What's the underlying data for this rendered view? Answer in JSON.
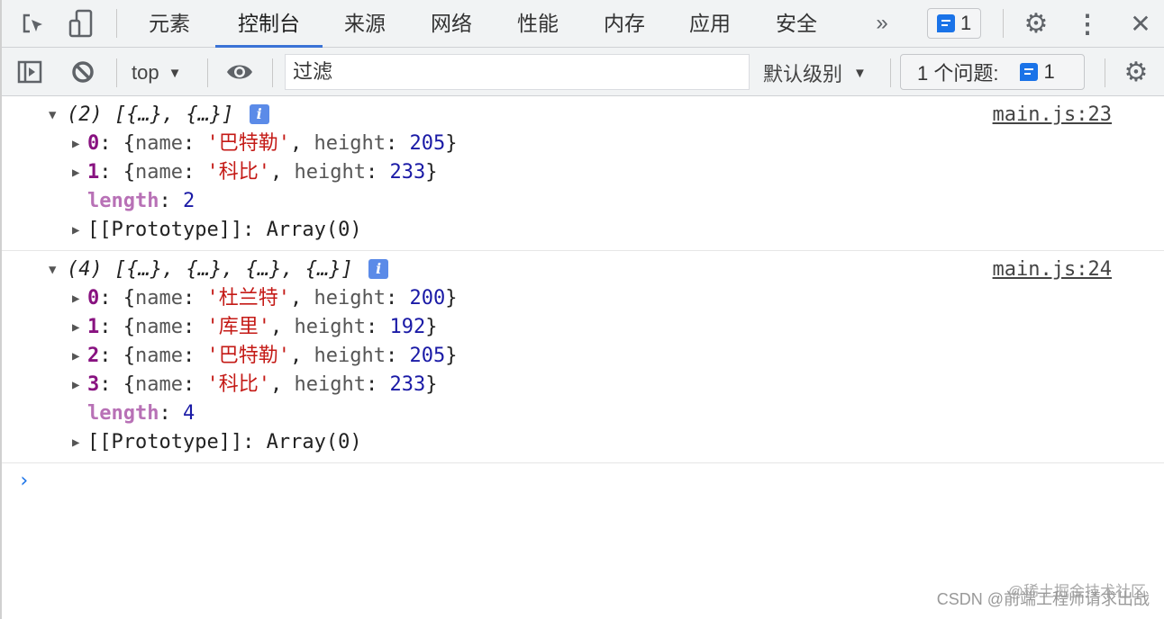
{
  "tabs": [
    {
      "label": "元素"
    },
    {
      "label": "控制台",
      "active": true
    },
    {
      "label": "来源"
    },
    {
      "label": "网络"
    },
    {
      "label": "性能"
    },
    {
      "label": "内存"
    },
    {
      "label": "应用"
    },
    {
      "label": "安全"
    }
  ],
  "more_tabs": "»",
  "issues_badge_count": "1",
  "toolbar": {
    "context": "top",
    "filter_placeholder": "过滤",
    "level": "默认级别",
    "issues_label": "1 个问题:",
    "issues_count": "1"
  },
  "groups": [
    {
      "header": "(2) [{…}, {…}]",
      "source": "main.js:23",
      "items": [
        {
          "index": "0",
          "name": "'巴特勒'",
          "height": "205"
        },
        {
          "index": "1",
          "name": "'科比'",
          "height": "233"
        }
      ],
      "length": "2",
      "prototype": "[[Prototype]]: Array(0)"
    },
    {
      "header": "(4) [{…}, {…}, {…}, {…}]",
      "source": "main.js:24",
      "items": [
        {
          "index": "0",
          "name": "'杜兰特'",
          "height": "200"
        },
        {
          "index": "1",
          "name": "'库里'",
          "height": "192"
        },
        {
          "index": "2",
          "name": "'巴特勒'",
          "height": "205"
        },
        {
          "index": "3",
          "name": "'科比'",
          "height": "233"
        }
      ],
      "length": "4",
      "prototype": "[[Prototype]]: Array(0)"
    }
  ],
  "labels": {
    "name_key": "name",
    "height_key": "height",
    "length_key": "length"
  },
  "prompt": "›",
  "watermark": {
    "line1": "@稀土掘金技术社区",
    "line2": "CSDN @前端工程师请求出战"
  },
  "colors": {
    "accent": "#1a73e8",
    "index": "#881280",
    "string": "#c41a16",
    "number": "#1a1aa6"
  }
}
